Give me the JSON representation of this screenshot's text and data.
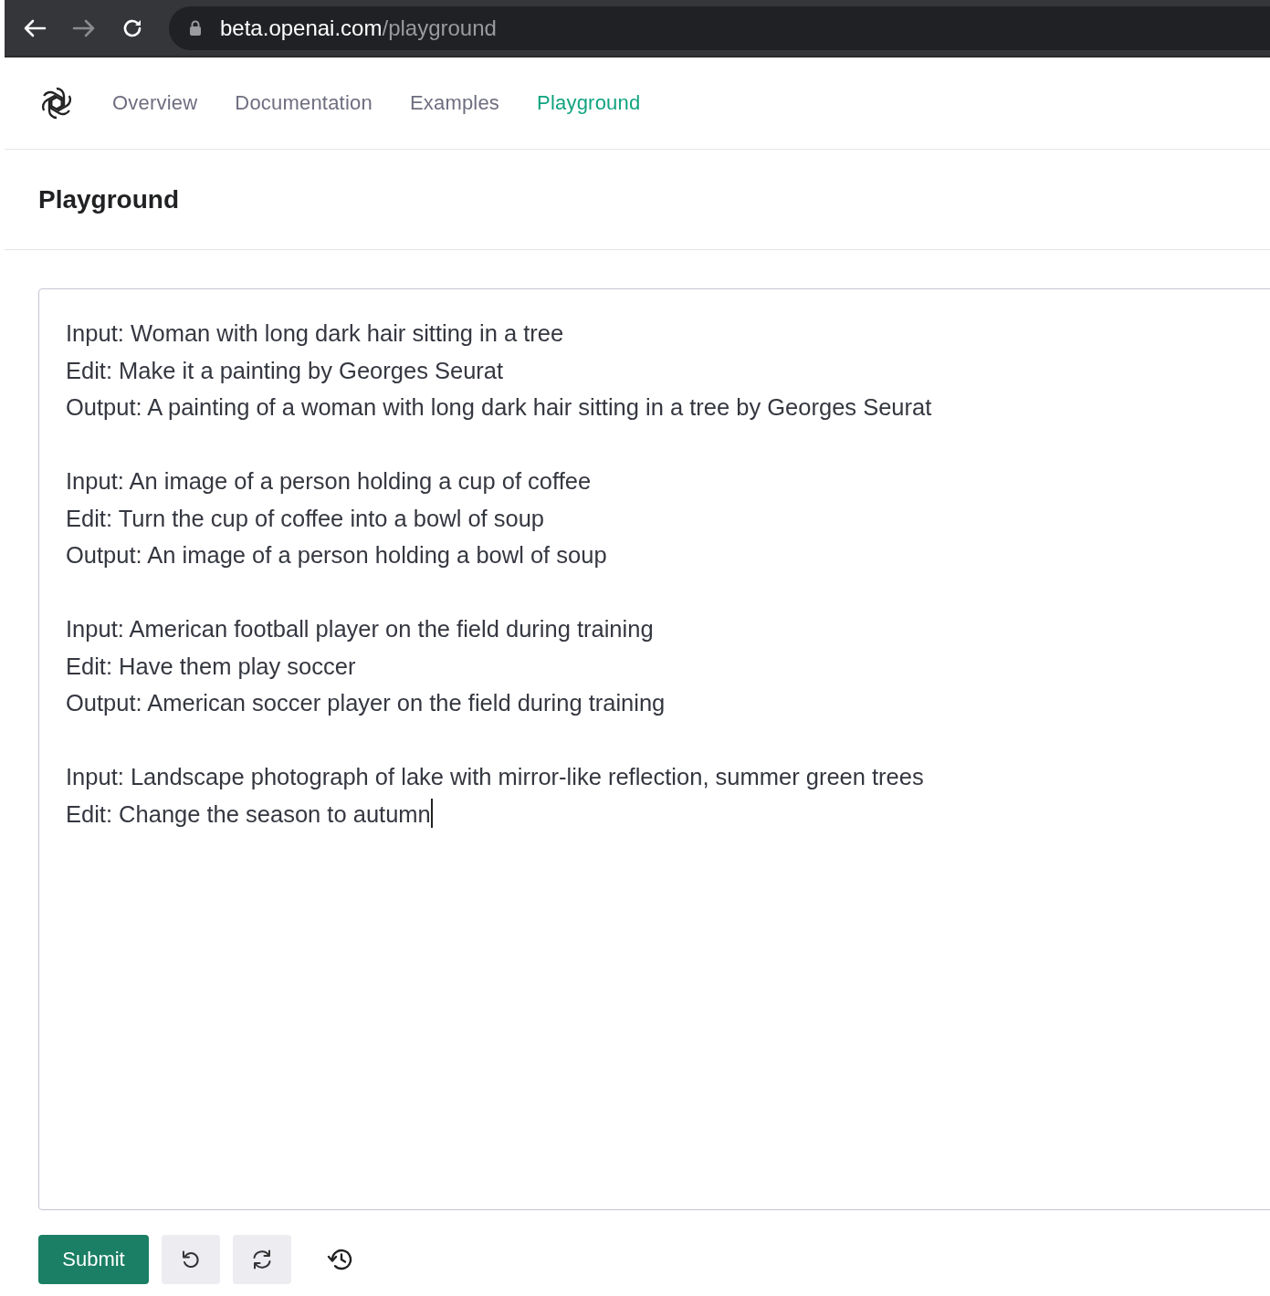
{
  "browser": {
    "url_host": "beta.openai.com",
    "url_path": "/playground"
  },
  "nav": [
    {
      "label": "Overview",
      "selected": false
    },
    {
      "label": "Documentation",
      "selected": false
    },
    {
      "label": "Examples",
      "selected": false
    },
    {
      "label": "Playground",
      "selected": true
    }
  ],
  "page_title": "Playground",
  "prompt": {
    "blocks": [
      [
        "Input: Woman with long dark hair sitting in a tree",
        "Edit: Make it a painting by Georges Seurat",
        "Output: A painting of a woman with long dark hair sitting in a tree by Georges Seurat"
      ],
      [
        "Input: An image of a person holding a cup of coffee",
        "Edit: Turn the cup of coffee into a bowl of soup",
        "Output: An image of a person holding a bowl of soup"
      ],
      [
        "Input: American football player on the field during training",
        "Edit: Have them play soccer",
        "Output: American soccer player on the field during training"
      ],
      [
        "Input: Landscape photograph of lake with mirror-like reflection, summer green trees",
        "Edit: Change the season to autumn"
      ]
    ]
  },
  "submit_label": "Submit"
}
